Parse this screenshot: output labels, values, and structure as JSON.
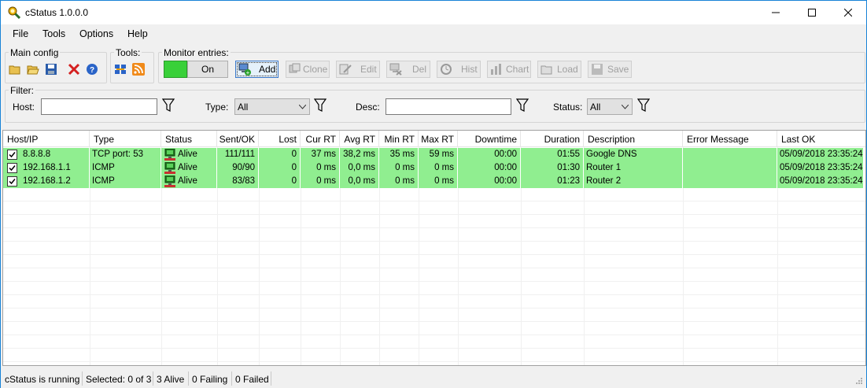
{
  "window": {
    "title": "cStatus 1.0.0.0"
  },
  "menu": [
    "File",
    "Tools",
    "Options",
    "Help"
  ],
  "groups": {
    "main_config": "Main config",
    "tools": "Tools:",
    "monitor_entries": "Monitor entries:",
    "filter": "Filter:"
  },
  "monitor": {
    "toggle_label": "On",
    "buttons": {
      "add": "Add",
      "clone": "Clone",
      "edit": "Edit",
      "del": "Del",
      "hist": "Hist",
      "chart": "Chart",
      "load": "Load",
      "save": "Save"
    }
  },
  "filter": {
    "host_label": "Host:",
    "host_value": "",
    "type_label": "Type:",
    "type_value": "All",
    "desc_label": "Desc:",
    "desc_value": "",
    "status_label": "Status:",
    "status_value": "All"
  },
  "table": {
    "columns": [
      "Host/IP",
      "Type",
      "Status",
      "Sent/OK",
      "Lost",
      "Cur RT",
      "Avg RT",
      "Min RT",
      "Max RT",
      "Downtime",
      "Duration",
      "Description",
      "Error Message",
      "Last OK"
    ],
    "rows": [
      {
        "host": "8.8.8.8",
        "type": "TCP port: 53",
        "status": "Alive",
        "sent_ok": "111/111",
        "lost": "0",
        "cur_rt": "37 ms",
        "avg_rt": "38,2 ms",
        "min_rt": "35 ms",
        "max_rt": "59 ms",
        "downtime": "00:00",
        "duration": "01:55",
        "description": "Google DNS",
        "error": "",
        "last_ok": "05/09/2018 23:35:24"
      },
      {
        "host": "192.168.1.1",
        "type": "ICMP",
        "status": "Alive",
        "sent_ok": "90/90",
        "lost": "0",
        "cur_rt": "0 ms",
        "avg_rt": "0,0 ms",
        "min_rt": "0 ms",
        "max_rt": "0 ms",
        "downtime": "00:00",
        "duration": "01:30",
        "description": "Router 1",
        "error": "",
        "last_ok": "05/09/2018 23:35:24"
      },
      {
        "host": "192.168.1.2",
        "type": "ICMP",
        "status": "Alive",
        "sent_ok": "83/83",
        "lost": "0",
        "cur_rt": "0 ms",
        "avg_rt": "0,0 ms",
        "min_rt": "0 ms",
        "max_rt": "0 ms",
        "downtime": "00:00",
        "duration": "01:23",
        "description": "Router 2",
        "error": "",
        "last_ok": "05/09/2018 23:35:24"
      }
    ]
  },
  "status": {
    "running": "cStatus is running",
    "selected": "Selected: 0 of 3",
    "alive": "3 Alive",
    "failing": "0 Failing",
    "failed": "0 Failed"
  },
  "colors": {
    "row_alive": "#90ee90",
    "toggle_on": "#39d039",
    "accent": "#1883d7"
  }
}
